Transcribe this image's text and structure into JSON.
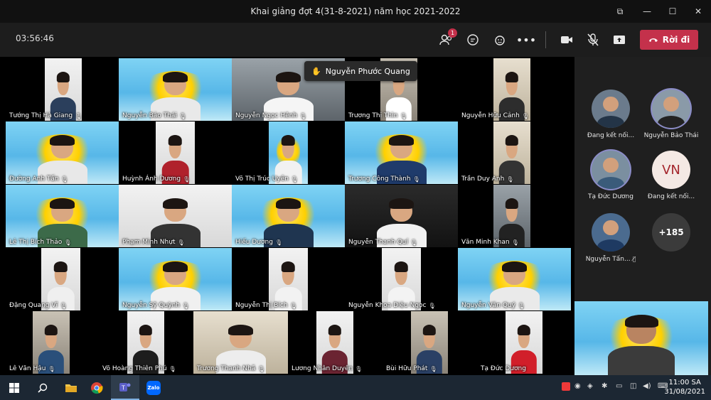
{
  "window": {
    "title": "Khai giảng đợt 4(31-8-2021) năm học 2021-2022"
  },
  "toolbar": {
    "timer": "03:56:46",
    "participants_badge": "1",
    "leave_label": "Rời đi"
  },
  "raised_hand": {
    "name": "Nguyễn Phước Quang"
  },
  "tiles": [
    {
      "name": "Tướng Thị Hà Giang",
      "muted": true
    },
    {
      "name": "Nguyễn Bảo Thái",
      "muted": true
    },
    {
      "name": "Nguyễn Ngọc Hênh",
      "muted": true
    },
    {
      "name": "Trương Thị Thìn",
      "muted": true
    },
    {
      "name": "Nguyễn Hữu Cảnh",
      "muted": true
    },
    {
      "name": "Đường Anh Tấn",
      "muted": true
    },
    {
      "name": "Huỳnh Ánh Dương",
      "muted": true
    },
    {
      "name": "Võ Thị Trúc Uyên",
      "muted": true
    },
    {
      "name": "Trương Công Thành",
      "muted": true
    },
    {
      "name": "Trần Duy Anh",
      "muted": true
    },
    {
      "name": "Lê Thị Bích Thảo",
      "muted": true
    },
    {
      "name": "Phạm Minh Nhựt",
      "muted": true
    },
    {
      "name": "Hiếu Dương",
      "muted": true
    },
    {
      "name": "Nguyễn Thanh Quí",
      "muted": true
    },
    {
      "name": "Văn Minh Khan",
      "muted": true
    },
    {
      "name": "Đặng Quang Vĩ",
      "muted": true
    },
    {
      "name": "Nguyễn Sỹ Quỳnh",
      "muted": true
    },
    {
      "name": "Nguyễn Thị Bích",
      "muted": true
    },
    {
      "name": "Nguyễn Khoa Diệu Ngọc",
      "muted": true
    },
    {
      "name": "Nguyễn Văn Quý",
      "muted": true
    },
    {
      "name": "Lê Văn Hậu",
      "muted": true
    },
    {
      "name": "Võ Hoàng Thiên Phú",
      "muted": true
    },
    {
      "name": "Trương Thanh Nhã",
      "muted": true
    },
    {
      "name": "Lương Nhân Duyên",
      "muted": true
    },
    {
      "name": "Bùi Hữu Phát",
      "muted": true
    },
    {
      "name": "Tạ Đức Dương",
      "muted": false
    }
  ],
  "panel": {
    "avatars": [
      {
        "label": "Đang kết nối..."
      },
      {
        "label": "Nguyễn Bảo Thái"
      },
      {
        "label": "Tạ Đức Dương"
      },
      {
        "label": "Đang kết nối...",
        "initials": "VN"
      },
      {
        "label": "Nguyễn Tấn..."
      },
      {
        "more": "+185"
      }
    ]
  },
  "taskbar": {
    "time": "11:00 SA",
    "date": "31/08/2021"
  },
  "colors": {
    "leave": "#c4314b",
    "toolbar": "#1d1d1d",
    "taskbar": "#1c2733",
    "panel": "#1f1f1f"
  }
}
